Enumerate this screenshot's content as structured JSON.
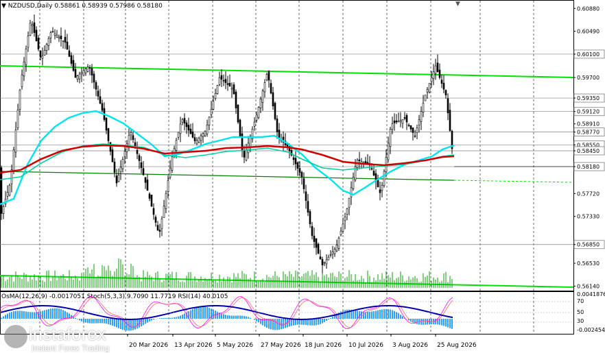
{
  "window": {
    "header": "NZDUSD,Daily  0.58861 0.58939 0.57986 0.58180",
    "close_icon": "close-icon",
    "dropdown_icon": "triangle-down-icon"
  },
  "main_axis": {
    "price_labels": [
      "0.60880",
      "0.60490",
      "0.60100",
      "0.59700",
      "0.59350",
      "0.59120",
      "0.58910",
      "0.58770",
      "0.58550",
      "0.58450",
      "0.58180",
      "0.57720",
      "0.57330",
      "0.56850",
      "0.56530",
      "0.56140"
    ],
    "highlighted": [
      "0.60100",
      "0.59350",
      "0.59120",
      "0.58770",
      "0.58550",
      "0.58450",
      "0.58180",
      "0.56850"
    ]
  },
  "date_axis": {
    "labels": [
      "20 Mar 2026",
      "13 Apr 2026",
      "5 May 2026",
      "27 May 2026",
      "18 Jun 2026",
      "10 Jul 2026",
      "3 Aug 2026",
      "25 Aug 2026"
    ]
  },
  "indicator": {
    "header": "OsMA(12,26,9) -0.0017051  Stoch(5,3,3) 9.7090 11.7719  RSI(14) 40.0105",
    "axis_labels": [
      "0.0041876",
      "70",
      "50",
      "30",
      "-0.002454"
    ]
  },
  "logo": {
    "name": "instaforex",
    "tagline": "Instant Forex Trading"
  },
  "colors": {
    "candles": "#000000",
    "ema_fast": "#00e5f0",
    "ema_mid": "#d00000",
    "trend_line": "#00e000",
    "rsi": "#0000aa",
    "osma": "#2aa0ff",
    "stoch": "#ff00ff",
    "background": "#ffffff"
  }
}
